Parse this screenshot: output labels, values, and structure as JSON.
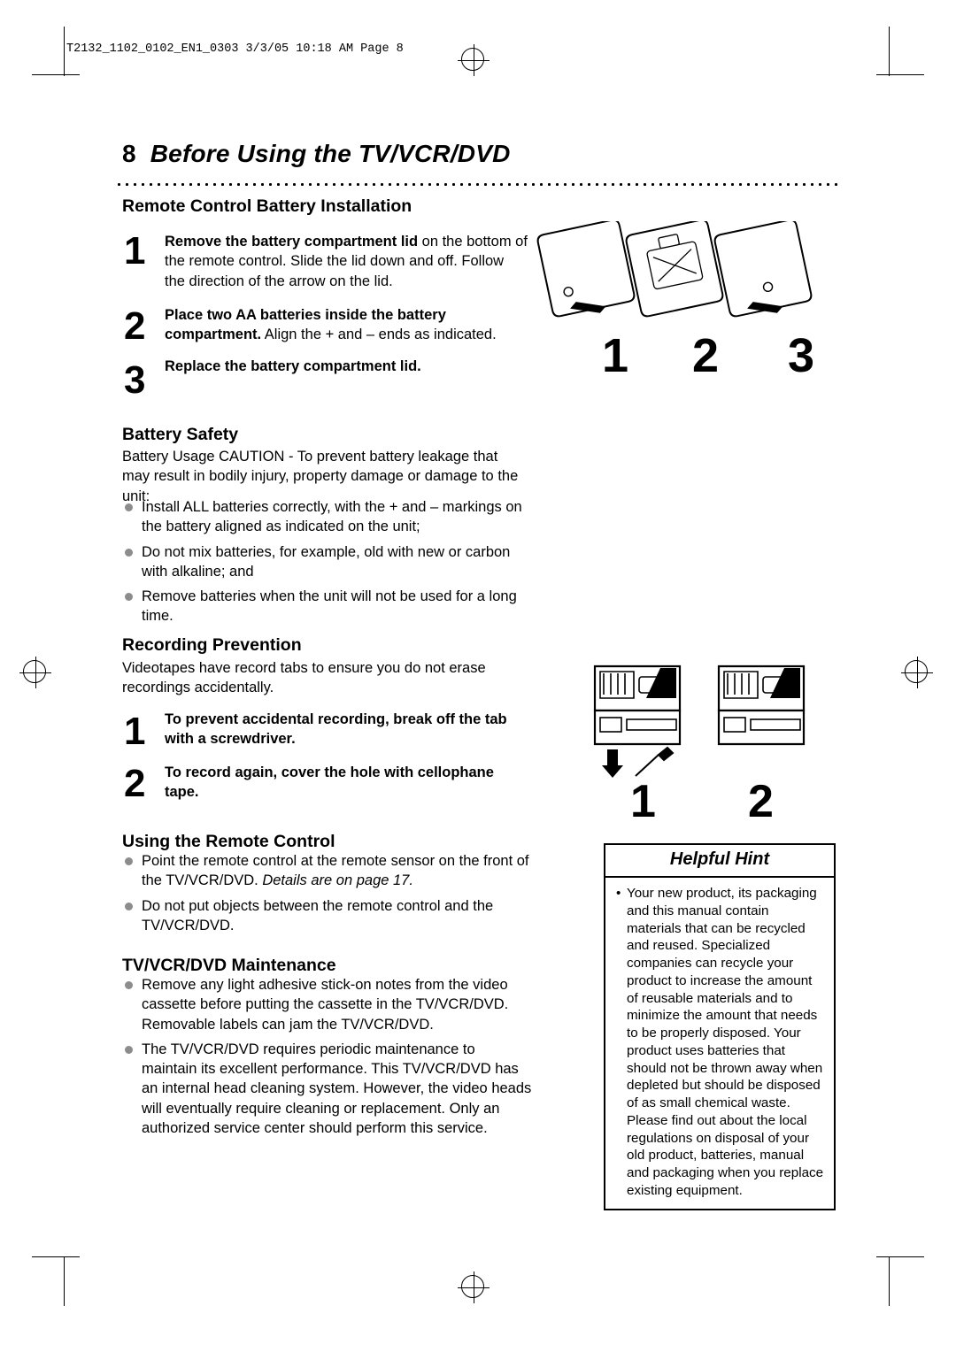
{
  "file_stamp": "T2132_1102_0102_EN1_0303  3/3/05  10:18 AM  Page 8",
  "page": {
    "number": "8",
    "title": "Before Using the TV/VCR/DVD"
  },
  "sections": {
    "battery_install": {
      "heading": "Remote Control Battery Installation",
      "steps": [
        {
          "num": "1",
          "bold": "Remove the battery compartment lid",
          "rest": " on the bottom of the remote control. Slide the lid down and off. Follow the direction of the arrow on the lid."
        },
        {
          "num": "2",
          "bold": "Place two AA batteries inside the battery compartment.",
          "rest": " Align the + and – ends as indicated."
        },
        {
          "num": "3",
          "bold": "Replace the battery compartment lid.",
          "rest": ""
        }
      ],
      "figure_labels": [
        "1",
        "2",
        "3"
      ]
    },
    "battery_safety": {
      "heading": "Battery Safety",
      "intro": "Battery Usage CAUTION - To prevent battery leakage that may result in bodily injury, property damage or damage to the unit:",
      "bullets": [
        "Install ALL batteries correctly, with the + and – markings on the battery aligned as indicated on the unit;",
        "Do not mix batteries, for example, old with new or carbon with alkaline; and",
        "Remove batteries when the unit will not be used for a long time."
      ]
    },
    "recording_prevention": {
      "heading": "Recording Prevention",
      "intro": "Videotapes have record tabs to ensure you do not erase recordings accidentally.",
      "steps": [
        {
          "num": "1",
          "bold": "To prevent accidental recording, break off the tab with a screwdriver."
        },
        {
          "num": "2",
          "bold": "To record again, cover the hole with cellophane tape."
        }
      ],
      "figure_labels": [
        "1",
        "2"
      ]
    },
    "using_remote": {
      "heading": "Using the Remote Control",
      "bullets": [
        {
          "text": "Point the remote control at the remote sensor on the front of the TV/VCR/DVD. ",
          "italic": "Details are on page 17."
        },
        {
          "text": "Do not put objects between the remote control and the TV/VCR/DVD.",
          "italic": ""
        }
      ]
    },
    "maintenance": {
      "heading": "TV/VCR/DVD Maintenance",
      "bullets": [
        "Remove any light adhesive stick-on notes from the video cassette before putting the cassette in the TV/VCR/DVD. Removable labels can jam the TV/VCR/DVD.",
        "The TV/VCR/DVD requires periodic maintenance to maintain its excellent performance. This TV/VCR/DVD has an internal head cleaning system. However, the video heads will eventually require cleaning or replacement. Only an authorized service center should perform this service."
      ]
    }
  },
  "hint": {
    "title": "Helpful Hint",
    "paragraph1": "Your new product, its packaging and this manual contain materials that can be recycled and reused. Specialized companies can recycle your product to increase the amount of reusable materials and to minimize the amount that needs to be properly disposed. Your product uses batteries that should not be thrown away when depleted but should be disposed of as small chemical waste.",
    "paragraph2": "Please find out about the local regulations on disposal of your old product, batteries, manual and packaging when you replace existing equipment."
  }
}
